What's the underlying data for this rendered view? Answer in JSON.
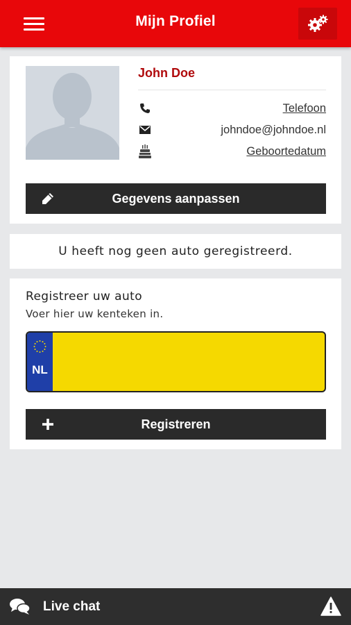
{
  "header": {
    "title": "Mijn Profiel",
    "menu_icon": "hamburger-menu-icon",
    "settings_icon": "gears-icon",
    "color": "#e8070a"
  },
  "profile": {
    "name": "John Doe",
    "phone_label": "Telefoon",
    "email": "johndoe@johndoe.nl",
    "birthdate_label": "Geboortedatum",
    "edit_button_label": "Gegevens aanpassen",
    "icons": [
      "phone-icon",
      "envelope-icon",
      "birthday-cake-icon",
      "pencil-icon"
    ]
  },
  "notice": {
    "text": "U heeft nog geen auto geregistreerd."
  },
  "register": {
    "title": "Registreer uw auto",
    "subtitle": "Voer hier uw kenteken in.",
    "plate_country": "NL",
    "plate_value": "",
    "button_label": "Registreren",
    "button_icon": "plus-icon"
  },
  "footer": {
    "chat_label": "Live chat",
    "chat_icon": "chat-bubbles-icon",
    "warning_icon": "warning-triangle-icon"
  }
}
